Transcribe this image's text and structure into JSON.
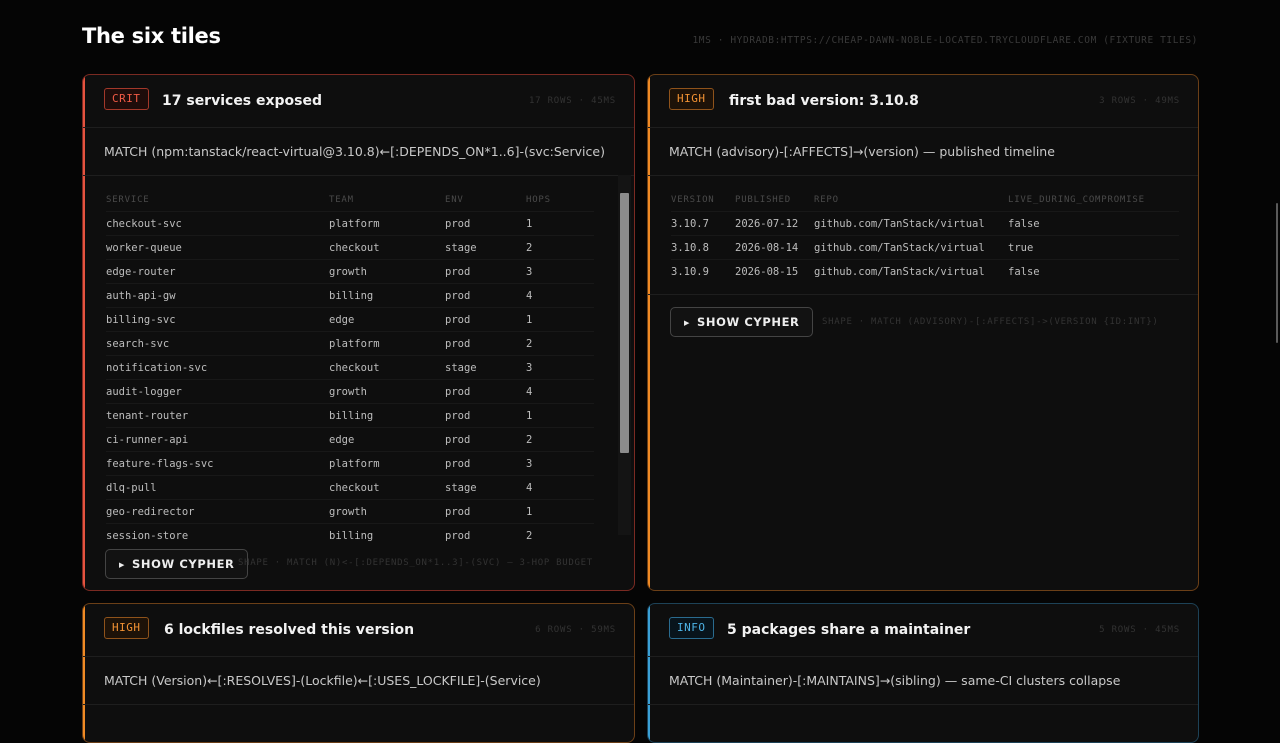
{
  "page": {
    "title": "The six tiles",
    "source": "1MS · HYDRADB:HTTPS://CHEAP-DAWN-NOBLE-LOCATED.TRYCLOUDFLARE.COM (FIXTURE TILES)"
  },
  "colors": {
    "crit": "#e5533f",
    "high": "#f08a24",
    "info": "#3aa0d6",
    "background": "#050505"
  },
  "tiles": [
    {
      "severity": "CRIT",
      "title": "17 services exposed",
      "meta": "17 ROWS · 45MS",
      "query": "MATCH (npm:tanstack/react-virtual@3.10.8)←[:DEPENDS_ON*1..6]-(svc:Service)",
      "columns": [
        "SERVICE",
        "TEAM",
        "ENV",
        "HOPS"
      ],
      "rows": [
        [
          "checkout-svc",
          "platform",
          "prod",
          "1"
        ],
        [
          "worker-queue",
          "checkout",
          "stage",
          "2"
        ],
        [
          "edge-router",
          "growth",
          "prod",
          "3"
        ],
        [
          "auth-api-gw",
          "billing",
          "prod",
          "4"
        ],
        [
          "billing-svc",
          "edge",
          "prod",
          "1"
        ],
        [
          "search-svc",
          "platform",
          "prod",
          "2"
        ],
        [
          "notification-svc",
          "checkout",
          "stage",
          "3"
        ],
        [
          "audit-logger",
          "growth",
          "prod",
          "4"
        ],
        [
          "tenant-router",
          "billing",
          "prod",
          "1"
        ],
        [
          "ci-runner-api",
          "edge",
          "prod",
          "2"
        ],
        [
          "feature-flags-svc",
          "platform",
          "prod",
          "3"
        ],
        [
          "dlq-pull",
          "checkout",
          "stage",
          "4"
        ],
        [
          "geo-redirector",
          "growth",
          "prod",
          "1"
        ],
        [
          "session-store",
          "billing",
          "prod",
          "2"
        ]
      ],
      "button_label": "SHOW CYPHER",
      "shape": "SHAPE · MATCH (N)<-[:DEPENDS_ON*1..3]-(SVC) — 3-HOP BUDGET"
    },
    {
      "severity": "HIGH",
      "title": "first bad version: 3.10.8",
      "meta": "3 ROWS · 49MS",
      "query": "MATCH (advisory)-[:AFFECTS]→(version) — published timeline",
      "columns": [
        "VERSION",
        "PUBLISHED",
        "REPO",
        "LIVE_DURING_COMPROMISE"
      ],
      "rows": [
        [
          "3.10.7",
          "2026-07-12",
          "github.com/TanStack/virtual",
          "false"
        ],
        [
          "3.10.8",
          "2026-08-14",
          "github.com/TanStack/virtual",
          "true"
        ],
        [
          "3.10.9",
          "2026-08-15",
          "github.com/TanStack/virtual",
          "false"
        ]
      ],
      "button_label": "SHOW CYPHER",
      "shape": "SHAPE · MATCH (ADVISORY)-[:AFFECTS]->(VERSION {ID:INT})"
    },
    {
      "severity": "HIGH",
      "title": "6 lockfiles resolved this version",
      "meta": "6 ROWS · 59MS",
      "query": "MATCH (Version)←[:RESOLVES]-(Lockfile)←[:USES_LOCKFILE]-(Service)"
    },
    {
      "severity": "INFO",
      "title": "5 packages share a maintainer",
      "meta": "5 ROWS · 45MS",
      "query": "MATCH (Maintainer)-[:MAINTAINS]→(sibling) — same-CI clusters collapse"
    }
  ]
}
